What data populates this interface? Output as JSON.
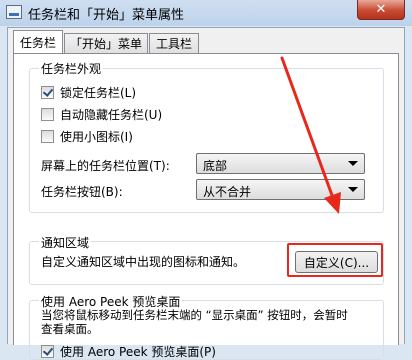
{
  "window": {
    "title": "任务栏和「开始」菜单属性",
    "close_glyph": "✕"
  },
  "tabs": [
    {
      "label": "任务栏",
      "active": true
    },
    {
      "label": "「开始」菜单",
      "active": false
    },
    {
      "label": "工具栏",
      "active": false
    }
  ],
  "taskbar_appearance": {
    "title": "任务栏外观",
    "checkboxes": [
      {
        "label": "锁定任务栏(L)",
        "checked": true
      },
      {
        "label": "自动隐藏任务栏(U)",
        "checked": false
      },
      {
        "label": "使用小图标(I)",
        "checked": false
      }
    ],
    "location_label": "屏幕上的任务栏位置(T):",
    "location_value": "底部",
    "buttons_label": "任务栏按钮(B):",
    "buttons_value": "从不合并"
  },
  "notification_area": {
    "title": "通知区域",
    "description": "自定义通知区域中出现的图标和通知。",
    "customize_button": "自定义(C)..."
  },
  "aero_peek": {
    "title": "使用 Aero Peek 预览桌面",
    "description_line1": "当您将鼠标移动到任务栏末端的 “显示桌面” 按钮时，会暂时",
    "description_line2": "查看桌面。",
    "checkbox_label": "使用 Aero Peek 预览桌面(P)",
    "checkbox_checked": true
  },
  "colors": {
    "annotation": "#e8281c",
    "close_button": "#c94a32"
  }
}
